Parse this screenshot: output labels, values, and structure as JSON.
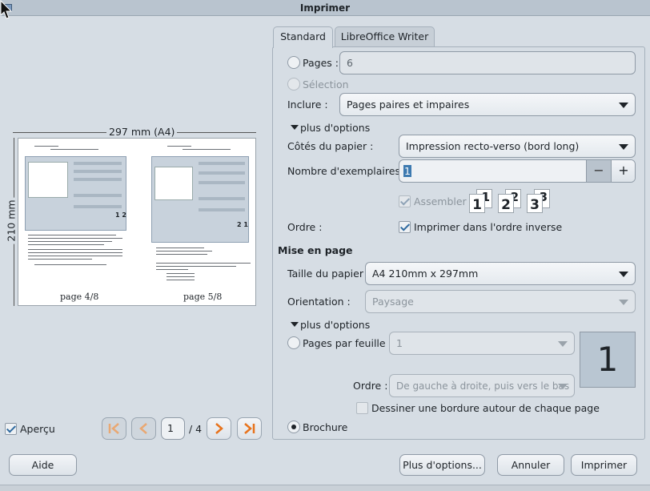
{
  "window": {
    "title": "Imprimer"
  },
  "tabs": [
    {
      "label": "Standard",
      "active": true
    },
    {
      "label": "LibreOffice Writer",
      "active": false
    }
  ],
  "preview": {
    "width_label": "297 mm (A4)",
    "height_label": "210 mm",
    "page_left_label": "page 4/8",
    "page_right_label": "page 5/8",
    "preview_checkbox_label": "Aperçu",
    "preview_checked": true,
    "current_page": "1",
    "total_pages": "/ 4",
    "left_badge": "1 2",
    "right_badge": "2 1"
  },
  "range": {
    "pages_label": "Pages :",
    "pages_value": "6",
    "selection_label": "Sélection",
    "include_label": "Inclure :",
    "include_value": "Pages paires et impaires"
  },
  "more_options_1": "plus d'options",
  "paper_sides": {
    "label": "Côtés du papier :",
    "value": "Impression recto-verso (bord long)"
  },
  "copies": {
    "label": "Nombre d'exemplaires :",
    "value": "1",
    "minus": "−",
    "plus": "+"
  },
  "collate": {
    "label": "Assembler",
    "checked": true,
    "icon_digits": [
      "1",
      "1",
      "2",
      "2",
      "3",
      "3"
    ]
  },
  "order": {
    "label": "Ordre :",
    "reverse_label": "Imprimer dans l'ordre inverse",
    "reverse_checked": true
  },
  "layout_section": "Mise en page",
  "paper_size": {
    "label": "Taille du papier :",
    "value": "A4 210mm x 297mm"
  },
  "orientation": {
    "label": "Orientation :",
    "value": "Paysage"
  },
  "more_options_2": "plus d'options",
  "pages_per_sheet": {
    "label": "Pages par feuille :",
    "value": "1",
    "preview_digit": "1"
  },
  "order2": {
    "label": "Ordre :",
    "value": "De gauche à droite, puis vers le bas"
  },
  "border": {
    "label": "Dessiner une bordure autour de chaque page",
    "checked": false
  },
  "brochure": {
    "label": "Brochure",
    "selected": true
  },
  "footer": {
    "help": "Aide",
    "more_options": "Plus d'options...",
    "cancel": "Annuler",
    "print": "Imprimer"
  },
  "colors": {
    "accent": "#e8731c",
    "background": "#d6dde4"
  }
}
